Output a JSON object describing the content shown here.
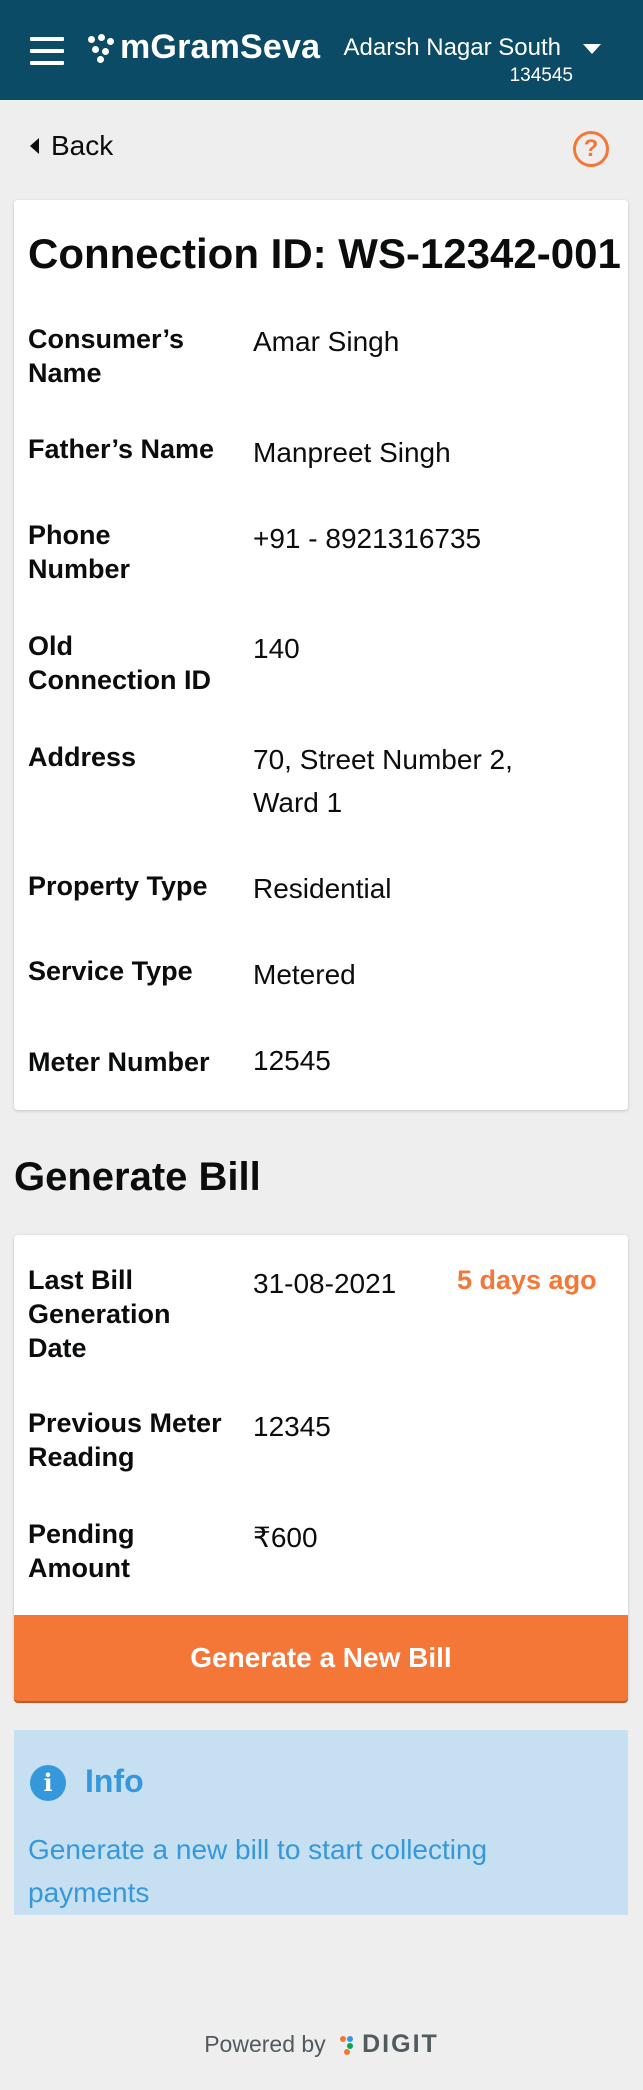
{
  "header": {
    "app_name": "mGramSeva",
    "location_name": "Adarsh Nagar South",
    "location_code": "134545",
    "background_color": "#0b4b66"
  },
  "nav": {
    "back_label": "Back",
    "help_icon": "?"
  },
  "connection": {
    "title": "Connection ID: WS-12342-001",
    "fields": [
      {
        "label": "Consumer’s Name",
        "value": "Amar Singh"
      },
      {
        "label": "Father’s Name",
        "value": "Manpreet Singh"
      },
      {
        "label": "Phone Number",
        "value": "+91 - 8921316735"
      },
      {
        "label": "Old Connection ID",
        "value": "140"
      },
      {
        "label": "Address",
        "value": "70, Street Number 2, Ward 1"
      },
      {
        "label": "Property Type",
        "value": "Residential"
      },
      {
        "label": "Service Type",
        "value": "Metered"
      },
      {
        "label": "Meter Number",
        "value": "12545"
      }
    ]
  },
  "generate_bill": {
    "section_title": "Generate Bill",
    "fields": [
      {
        "label": "Last Bill Generation Date",
        "value": "31-08-2021",
        "badge": "5 days ago"
      },
      {
        "label": "Previous Meter Reading",
        "value": "12345"
      },
      {
        "label": "Pending Amount",
        "value": "₹600"
      }
    ],
    "button_label": "Generate a New Bill",
    "accent_color": "#f47738"
  },
  "info": {
    "icon": "i",
    "title": "Info",
    "text": "Generate a new bill to start collecting payments",
    "color": "#3498db"
  },
  "footer": {
    "powered_by": "Powered by",
    "brand": "DIGIT"
  }
}
